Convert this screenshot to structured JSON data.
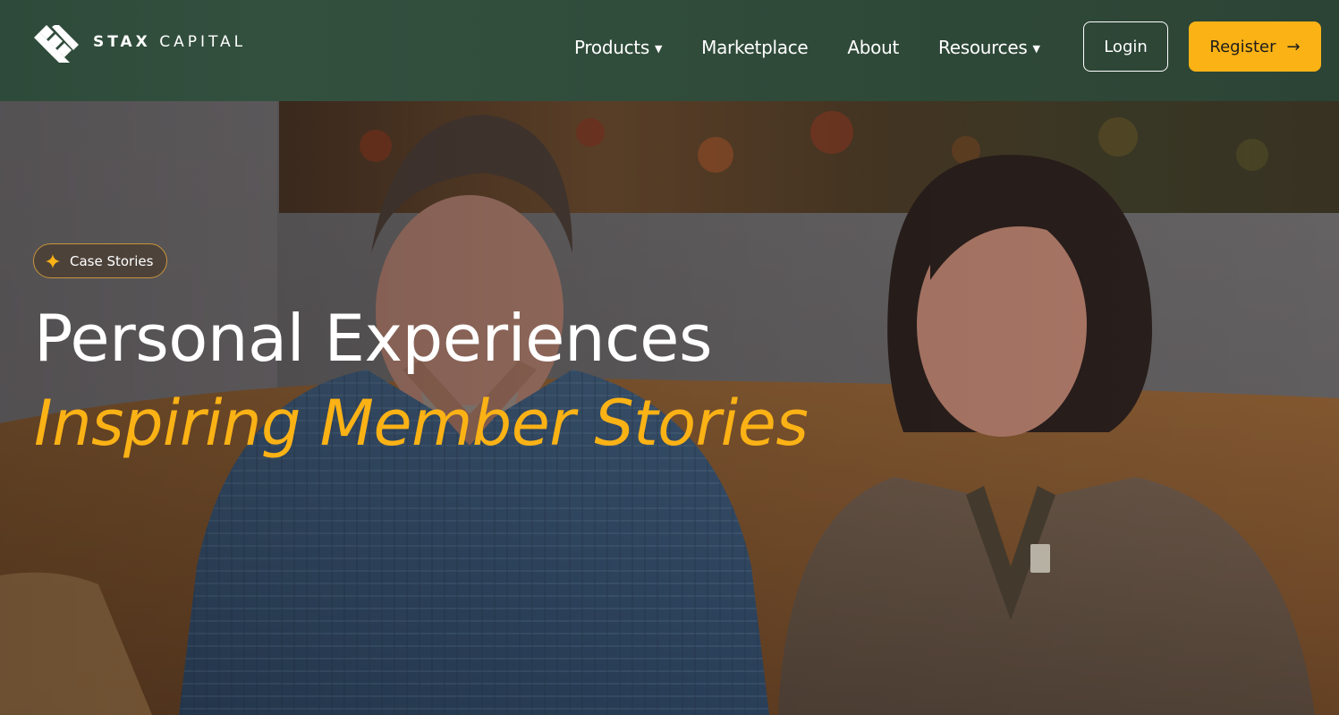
{
  "brand": {
    "name_bold": "STAX",
    "name_light": "CAPITAL"
  },
  "nav": {
    "products": "Products",
    "marketplace": "Marketplace",
    "about": "About",
    "resources": "Resources"
  },
  "auth": {
    "login": "Login",
    "register": "Register"
  },
  "hero": {
    "badge": "Case Stories",
    "title": "Personal Experiences",
    "subtitle": "Inspiring Member Stories"
  },
  "colors": {
    "header_bg": "#2e4a3a",
    "accent": "#fbb215",
    "text": "#ffffff"
  },
  "icons": {
    "logo": "stax-logo-icon",
    "caret": "caret-down-icon",
    "arrow": "arrow-right-icon",
    "sparkle": "sparkle-icon"
  }
}
